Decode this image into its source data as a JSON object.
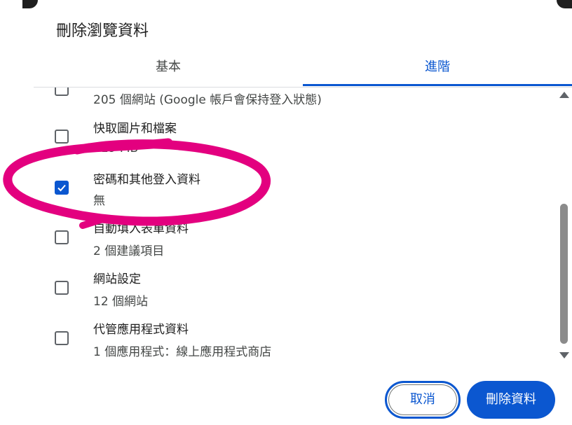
{
  "dialog": {
    "title": "刪除瀏覽資料"
  },
  "tabs": [
    {
      "label": "基本",
      "selected": false
    },
    {
      "label": "進階",
      "selected": true
    }
  ],
  "items": [
    {
      "title": "",
      "subtitle": "205 個網站 (Google 帳戶會保持登入狀態)",
      "checked": false
    },
    {
      "title": "快取圖片和檔案",
      "subtitle": "319 MB",
      "checked": false
    },
    {
      "title": "密碼和其他登入資料",
      "subtitle": "無",
      "checked": true
    },
    {
      "title": "自動填入表單資料",
      "subtitle": "2 個建議項目",
      "checked": false
    },
    {
      "title": "網站設定",
      "subtitle": "12 個網站",
      "checked": false
    },
    {
      "title": "代管應用程式資料",
      "subtitle": "1 個應用程式：線上應用程式商店",
      "checked": false
    }
  ],
  "buttons": {
    "cancel": "取消",
    "delete": "刪除資料"
  },
  "colors": {
    "accent": "#0b57d0",
    "annotation": "#e3007f"
  }
}
